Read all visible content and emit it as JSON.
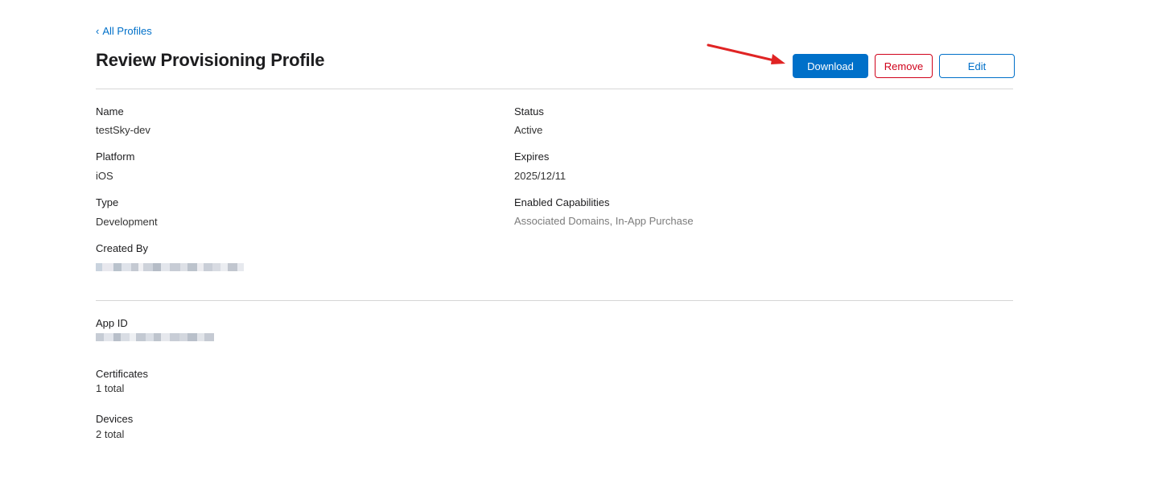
{
  "nav": {
    "back_chevron": "‹",
    "back_label": "All Profiles"
  },
  "header": {
    "title": "Review Provisioning Profile"
  },
  "actions": {
    "download_label": "Download",
    "remove_label": "Remove",
    "edit_label": "Edit"
  },
  "details": {
    "name_label": "Name",
    "name_value": "testSky-dev",
    "platform_label": "Platform",
    "platform_value": "iOS",
    "type_label": "Type",
    "type_value": "Development",
    "created_by_label": "Created By",
    "status_label": "Status",
    "status_value": "Active",
    "expires_label": "Expires",
    "expires_value": "2025/12/11",
    "capabilities_label": "Enabled Capabilities",
    "capabilities_value": "Associated Domains, In-App Purchase"
  },
  "relations": {
    "app_id_label": "App ID",
    "certificates_label": "Certificates",
    "certificates_value": "1 total",
    "devices_label": "Devices",
    "devices_value": "2 total"
  },
  "colors": {
    "accent": "#0070c9",
    "danger": "#d0021b",
    "annotation_arrow": "#e02424"
  }
}
